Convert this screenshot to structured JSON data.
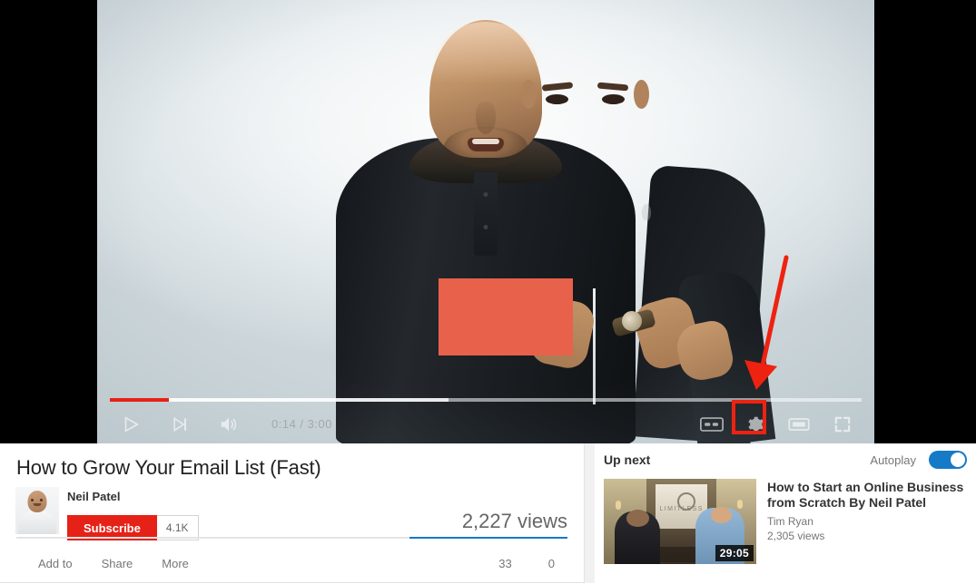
{
  "player": {
    "time_display": "0:14 / 3:00",
    "progress_percent": 7.9,
    "loaded_percent": 45,
    "controls": {
      "play_label": "play-button",
      "next_label": "next-video-button",
      "volume_label": "volume-button",
      "captions_label": "CC",
      "settings_label": "settings-button",
      "theater_label": "theater-mode-button",
      "fullscreen_label": "fullscreen-button"
    },
    "annotation": {
      "arrow_color": "#ee2211",
      "highlight_color": "#ee2211",
      "highlight_target": "captions-button"
    },
    "redaction_color": "#e8614a",
    "thumbnail_logo_text": "LIMITLESS"
  },
  "video": {
    "title": "How to Grow Your Email List (Fast)",
    "channel": "Neil Patel",
    "subscribe_label": "Subscribe",
    "subscriber_count": "4.1K",
    "views": "2,227 views",
    "actions": [
      {
        "label": "Add to"
      },
      {
        "label": "Share"
      },
      {
        "label": "More"
      }
    ],
    "likes": "33",
    "dislikes": "0"
  },
  "sidebar": {
    "up_next_label": "Up next",
    "autoplay_label": "Autoplay",
    "autoplay_on": true,
    "suggestion": {
      "title": "How to Start an Online Business from Scratch By Neil Patel",
      "channel": "Tim Ryan",
      "views": "2,305 views",
      "duration": "29:05"
    }
  },
  "colors": {
    "brand_red": "#e62117",
    "accent_blue": "#167ac6",
    "annotation_red": "#ee2211"
  }
}
